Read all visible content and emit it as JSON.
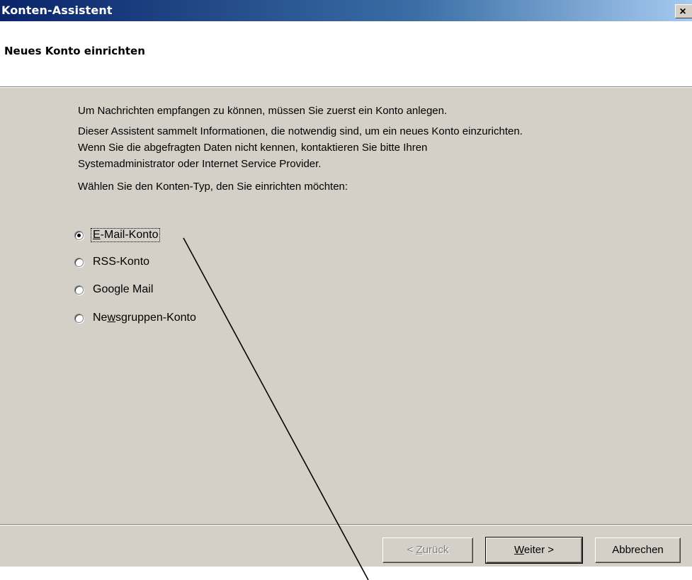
{
  "window": {
    "title": "Konten-Assistent",
    "close_glyph": "×"
  },
  "header": {
    "title": "Neues Konto einrichten"
  },
  "intro": {
    "line1": "Um Nachrichten empfangen zu können, müssen Sie zuerst ein Konto anlegen.",
    "line2": "Dieser Assistent sammelt Informationen, die notwendig sind, um ein neues Konto einzurichten.",
    "line3": "Wenn Sie die abgefragten Daten nicht kennen, kontaktieren Sie bitte Ihren",
    "line4": "Systemadministrator oder Internet Service Provider.",
    "prompt": "Wählen Sie den Konten-Typ, den Sie einrichten möchten:"
  },
  "account_types": {
    "selected": "E-Mail-Konto",
    "email": {
      "pre": "",
      "access": "E",
      "post": "-Mail-Konto"
    },
    "rss": {
      "label": "RSS-Konto"
    },
    "google": {
      "label": "Google Mail"
    },
    "news": {
      "pre": "Ne",
      "access": "w",
      "post": "sgruppen-Konto"
    }
  },
  "buttons": {
    "back": {
      "pre": "< ",
      "access": "Z",
      "post": "urück",
      "enabled": false
    },
    "next": {
      "pre": "",
      "access": "W",
      "post": "eiter >"
    },
    "cancel": {
      "label": "Abbrechen"
    }
  },
  "colors": {
    "face": "#d4d0c8",
    "title_start": "#0a246a",
    "title_end": "#a6caf0"
  }
}
